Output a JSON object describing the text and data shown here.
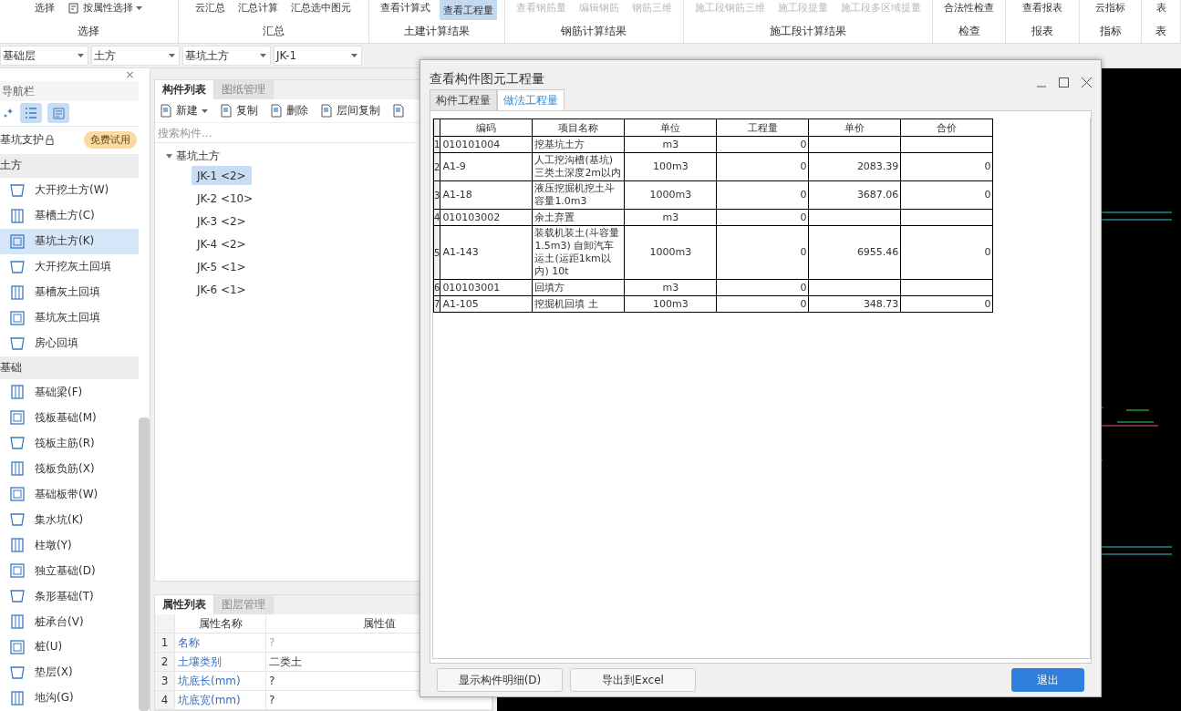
{
  "ribbon": {
    "groups": [
      {
        "label": "选择",
        "buttons": [
          {
            "label": "选择",
            "disabled": false,
            "selected": false
          },
          {
            "label": "按属性选择",
            "disabled": false,
            "selected": false,
            "kind": "dropdown"
          }
        ]
      },
      {
        "label": "汇总",
        "buttons": [
          {
            "label": "云汇总",
            "disabled": false,
            "selected": false
          },
          {
            "label": "汇总计算",
            "disabled": false,
            "selected": false
          },
          {
            "label": "汇总选中图元",
            "disabled": false,
            "selected": false
          }
        ]
      },
      {
        "label": "土建计算结果",
        "buttons": [
          {
            "label": "查看计算式",
            "disabled": false,
            "selected": false
          },
          {
            "label": "查看工程量",
            "disabled": false,
            "selected": true
          }
        ]
      },
      {
        "label": "钢筋计算结果",
        "buttons": [
          {
            "label": "查看钢筋量",
            "disabled": true,
            "selected": false
          },
          {
            "label": "编辑钢筋",
            "disabled": true,
            "selected": false
          },
          {
            "label": "钢筋三维",
            "disabled": true,
            "selected": false
          }
        ]
      },
      {
        "label": "施工段计算结果",
        "buttons": [
          {
            "label": "施工段钢筋三维",
            "disabled": true,
            "selected": false
          },
          {
            "label": "施工段提量",
            "disabled": true,
            "selected": false
          },
          {
            "label": "施工段多区域提量",
            "disabled": true,
            "selected": false
          }
        ]
      },
      {
        "label": "检查",
        "buttons": [
          {
            "label": "合法性检查",
            "disabled": false,
            "selected": false
          }
        ]
      },
      {
        "label": "报表",
        "buttons": [
          {
            "label": "查看报表",
            "disabled": false,
            "selected": false
          }
        ]
      },
      {
        "label": "指标",
        "buttons": [
          {
            "label": "云指标",
            "disabled": false,
            "selected": false
          }
        ]
      },
      {
        "label": "表",
        "buttons": [
          {
            "label": "表",
            "disabled": false,
            "selected": false
          }
        ]
      }
    ]
  },
  "selectors": [
    {
      "value": "基础层"
    },
    {
      "value": "土方"
    },
    {
      "value": "基坑土方"
    },
    {
      "value": "JK-1"
    }
  ],
  "nav": {
    "title": "导航栏",
    "close": "×",
    "promo": {
      "label": "基坑支护",
      "locked": true,
      "badge": "免费试用"
    },
    "groups": [
      {
        "label": "土方",
        "children": [
          {
            "label": "大开挖土方(W)",
            "selected": false
          },
          {
            "label": "基槽土方(C)",
            "selected": false
          },
          {
            "label": "基坑土方(K)",
            "selected": true
          },
          {
            "label": "大开挖灰土回填",
            "selected": false
          },
          {
            "label": "基槽灰土回填",
            "selected": false
          },
          {
            "label": "基坑灰土回填",
            "selected": false
          },
          {
            "label": "房心回填",
            "selected": false
          }
        ]
      },
      {
        "label": "基础",
        "children": [
          {
            "label": "基础梁(F)",
            "selected": false
          },
          {
            "label": "筏板基础(M)",
            "selected": false
          },
          {
            "label": "筏板主筋(R)",
            "selected": false
          },
          {
            "label": "筏板负筋(X)",
            "selected": false
          },
          {
            "label": "基础板带(W)",
            "selected": false
          },
          {
            "label": "集水坑(K)",
            "selected": false
          },
          {
            "label": "柱墩(Y)",
            "selected": false
          },
          {
            "label": "独立基础(D)",
            "selected": false
          },
          {
            "label": "条形基础(T)",
            "selected": false
          },
          {
            "label": "桩承台(V)",
            "selected": false
          },
          {
            "label": "桩(U)",
            "selected": false
          },
          {
            "label": "垫层(X)",
            "selected": false
          },
          {
            "label": "地沟(G)",
            "selected": false
          }
        ]
      }
    ]
  },
  "component_panel": {
    "tabs": [
      {
        "label": "构件列表",
        "selected": true
      },
      {
        "label": "图纸管理",
        "selected": false
      }
    ],
    "toolbar": [
      {
        "label": "新建",
        "kind": "dropdown"
      },
      {
        "label": "复制",
        "kind": "button"
      },
      {
        "label": "删除",
        "kind": "button"
      },
      {
        "label": "层间复制",
        "kind": "button"
      },
      {
        "kind": "icon"
      }
    ],
    "search": {
      "placeholder": "搜索构件..."
    },
    "tree": [
      {
        "label": "基坑土方",
        "expanded": true,
        "children": [
          {
            "label": "JK-1 <2>",
            "selected": true
          },
          {
            "label": "JK-2 <10>",
            "selected": false
          },
          {
            "label": "JK-3 <2>",
            "selected": false
          },
          {
            "label": "JK-4 <2>",
            "selected": false
          },
          {
            "label": "JK-5 <1>",
            "selected": false
          },
          {
            "label": "JK-6 <1>",
            "selected": false
          }
        ]
      }
    ]
  },
  "property_panel": {
    "tabs": [
      {
        "label": "属性列表",
        "selected": true
      },
      {
        "label": "图层管理",
        "selected": false
      }
    ],
    "columns": [
      "属性名称",
      "属性值"
    ],
    "rows": [
      {
        "index": "1",
        "name": "名称",
        "value": "?",
        "muted": true
      },
      {
        "index": "2",
        "name": "土壤类别",
        "value": "二类土",
        "muted": false
      },
      {
        "index": "3",
        "name": "坑底长(mm)",
        "value": "?",
        "muted": false
      },
      {
        "index": "4",
        "name": "坑底宽(mm)",
        "value": "?",
        "muted": false
      }
    ]
  },
  "dialog": {
    "title": "查看构件图元工程量",
    "tabs": [
      {
        "label": "构件工程量",
        "selected": false
      },
      {
        "label": "做法工程量",
        "selected": true
      }
    ],
    "table": {
      "columns": [
        "编码",
        "项目名称",
        "单位",
        "工程量",
        "单价",
        "合价"
      ],
      "rows": [
        {
          "index": "1",
          "cells": [
            "010101004",
            "挖基坑土方",
            "m3",
            "0",
            "",
            ""
          ]
        },
        {
          "index": "2",
          "cells": [
            "A1-9",
            "人工挖沟槽(基坑)三类土深度2m以内",
            "100m3",
            "0",
            "2083.39",
            "0"
          ]
        },
        {
          "index": "3",
          "cells": [
            "A1-18",
            "液压挖掘机挖土斗容量1.0m3",
            "1000m3",
            "0",
            "3687.06",
            "0"
          ]
        },
        {
          "index": "4",
          "cells": [
            "010103002",
            "余土弃置",
            "m3",
            "0",
            "",
            ""
          ]
        },
        {
          "index": "5",
          "cells": [
            "A1-143",
            "装载机装土(斗容量1.5m3) 自卸汽车运土(运距1km以内) 10t",
            "1000m3",
            "0",
            "6955.46",
            "0"
          ]
        },
        {
          "index": "6",
          "cells": [
            "010103001",
            "回填方",
            "m3",
            "0",
            "",
            ""
          ]
        },
        {
          "index": "7",
          "cells": [
            "A1-105",
            "挖掘机回填 土",
            "100m3",
            "0",
            "348.73",
            "0"
          ]
        }
      ]
    },
    "buttons": [
      {
        "label": "显示构件明细(D)",
        "kind": "secondary"
      },
      {
        "label": "导出到Excel",
        "kind": "secondary"
      },
      {
        "label": "退出",
        "kind": "primary"
      }
    ]
  }
}
